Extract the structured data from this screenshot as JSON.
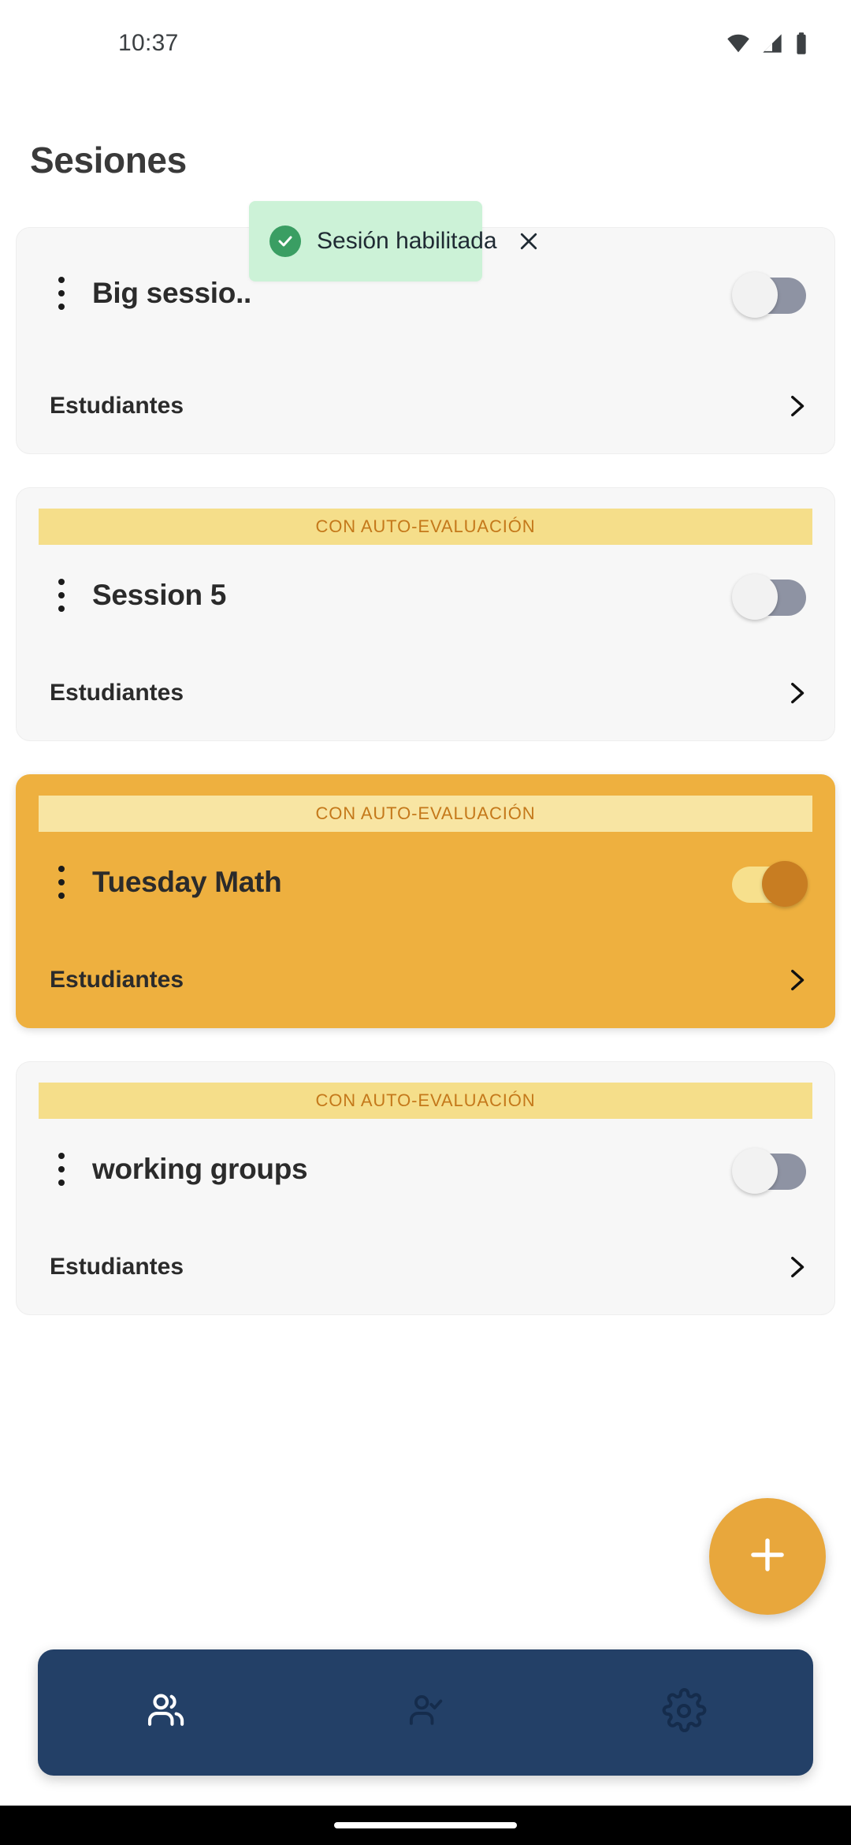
{
  "status_bar": {
    "time": "10:37",
    "icons": [
      "wifi-icon",
      "cell-signal-icon",
      "battery-icon"
    ]
  },
  "header": {
    "title": "Sesiones"
  },
  "toast": {
    "message": "Sesión habilitada",
    "icon": "check-circle-icon",
    "close_icon": "close-icon",
    "background": "#ccf2d7",
    "icon_color": "#3a9e63"
  },
  "sessions": [
    {
      "name": "Big sessio..",
      "banner": null,
      "enabled": false,
      "highlighted": false,
      "students_label": "Estudiantes",
      "menu_icon": "more-vertical-icon",
      "chevron_icon": "chevron-right-icon"
    },
    {
      "name": "Session 5",
      "banner": "CON AUTO-EVALUACIÓN",
      "enabled": false,
      "highlighted": false,
      "students_label": "Estudiantes",
      "menu_icon": "more-vertical-icon",
      "chevron_icon": "chevron-right-icon"
    },
    {
      "name": "Tuesday Math",
      "banner": "CON AUTO-EVALUACIÓN",
      "enabled": true,
      "highlighted": true,
      "students_label": "Estudiantes",
      "menu_icon": "more-vertical-icon",
      "chevron_icon": "chevron-right-icon"
    },
    {
      "name": "working groups",
      "banner": "CON AUTO-EVALUACIÓN",
      "enabled": false,
      "highlighted": false,
      "students_label": "Estudiantes",
      "menu_icon": "more-vertical-icon",
      "chevron_icon": "chevron-right-icon"
    }
  ],
  "fab": {
    "icon": "plus-icon",
    "color": "#e8a73c"
  },
  "bottom_nav": {
    "background": "#234067",
    "items": [
      {
        "icon": "people-group-icon",
        "active": true
      },
      {
        "icon": "person-check-icon",
        "active": false
      },
      {
        "icon": "gear-icon",
        "active": false
      }
    ]
  },
  "colors": {
    "accent": "#e8a73c",
    "card_highlight": "#eeb03f",
    "banner_bg": "#f5de8a",
    "banner_text": "#c4781a",
    "nav_bg": "#234067",
    "toast_bg": "#ccf2d7"
  }
}
